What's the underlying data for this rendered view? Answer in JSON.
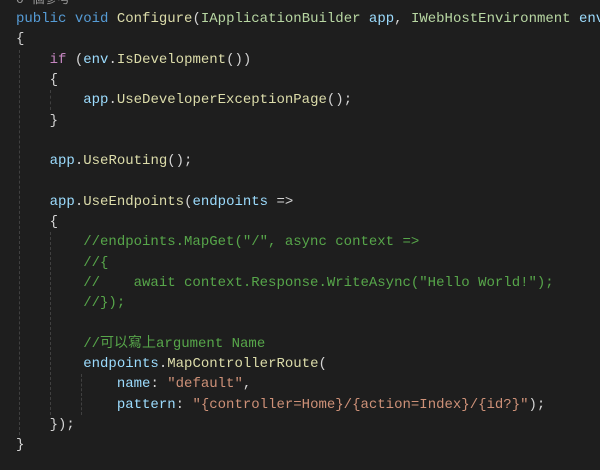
{
  "codelens": "0 個參考",
  "lines": [
    [
      {
        "t": "public",
        "c": "kw"
      },
      {
        "t": " "
      },
      {
        "t": "void",
        "c": "kw"
      },
      {
        "t": " "
      },
      {
        "t": "Configure",
        "c": "fn"
      },
      {
        "t": "("
      },
      {
        "t": "IApplicationBuilder",
        "c": "iface"
      },
      {
        "t": " "
      },
      {
        "t": "app",
        "c": "id"
      },
      {
        "t": ", "
      },
      {
        "t": "IWebHostEnvironment",
        "c": "iface"
      },
      {
        "t": " "
      },
      {
        "t": "env",
        "c": "id"
      },
      {
        "t": ")"
      }
    ],
    [
      {
        "t": "{"
      }
    ],
    [
      {
        "t": "    "
      },
      {
        "t": "if",
        "c": "ctl"
      },
      {
        "t": " ("
      },
      {
        "t": "env",
        "c": "id"
      },
      {
        "t": "."
      },
      {
        "t": "IsDevelopment",
        "c": "fn"
      },
      {
        "t": "())"
      }
    ],
    [
      {
        "t": "    {"
      }
    ],
    [
      {
        "t": "        "
      },
      {
        "t": "app",
        "c": "id"
      },
      {
        "t": "."
      },
      {
        "t": "UseDeveloperExceptionPage",
        "c": "fn"
      },
      {
        "t": "();"
      }
    ],
    [
      {
        "t": "    }"
      }
    ],
    [],
    [
      {
        "t": "    "
      },
      {
        "t": "app",
        "c": "id"
      },
      {
        "t": "."
      },
      {
        "t": "UseRouting",
        "c": "fn"
      },
      {
        "t": "();"
      }
    ],
    [],
    [
      {
        "t": "    "
      },
      {
        "t": "app",
        "c": "id"
      },
      {
        "t": "."
      },
      {
        "t": "UseEndpoints",
        "c": "fn"
      },
      {
        "t": "("
      },
      {
        "t": "endpoints",
        "c": "id"
      },
      {
        "t": " =>"
      }
    ],
    [
      {
        "t": "    {"
      }
    ],
    [
      {
        "t": "        "
      },
      {
        "t": "//endpoints.MapGet(\"/\", async context =>",
        "c": "cmt"
      }
    ],
    [
      {
        "t": "        "
      },
      {
        "t": "//{",
        "c": "cmt"
      }
    ],
    [
      {
        "t": "        "
      },
      {
        "t": "//    await context.Response.WriteAsync(\"Hello World!\");",
        "c": "cmt"
      }
    ],
    [
      {
        "t": "        "
      },
      {
        "t": "//});",
        "c": "cmt"
      }
    ],
    [],
    [
      {
        "t": "        "
      },
      {
        "t": "//可以寫上argument Name",
        "c": "cmt"
      }
    ],
    [
      {
        "t": "        "
      },
      {
        "t": "endpoints",
        "c": "id"
      },
      {
        "t": "."
      },
      {
        "t": "MapControllerRoute",
        "c": "fn"
      },
      {
        "t": "("
      }
    ],
    [
      {
        "t": "            "
      },
      {
        "t": "name",
        "c": "id"
      },
      {
        "t": ": "
      },
      {
        "t": "\"default\"",
        "c": "str"
      },
      {
        "t": ","
      }
    ],
    [
      {
        "t": "            "
      },
      {
        "t": "pattern",
        "c": "id"
      },
      {
        "t": ": "
      },
      {
        "t": "\"{controller=Home}/{action=Index}/{id?}\"",
        "c": "str"
      },
      {
        "t": ");"
      }
    ],
    [
      {
        "t": "    });"
      }
    ],
    [
      {
        "t": "}"
      }
    ]
  ]
}
